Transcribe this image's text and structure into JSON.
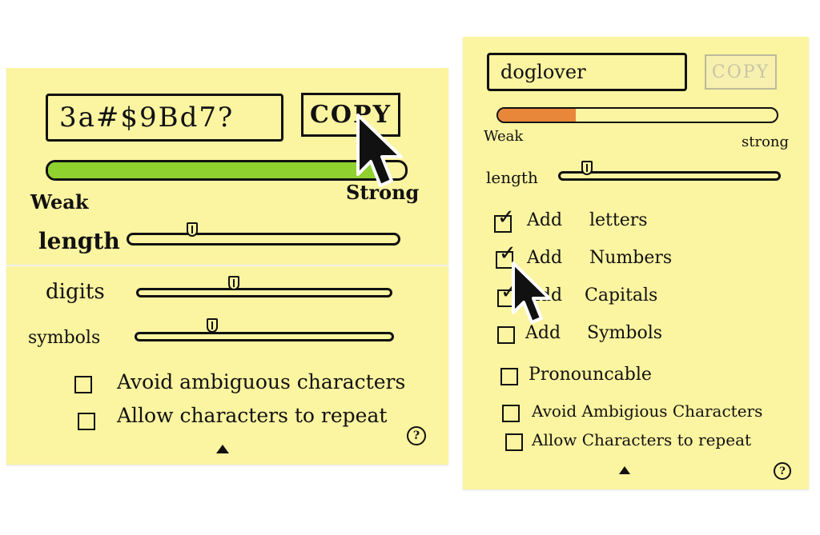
{
  "left": {
    "password_value": "3a#$9Bd7?",
    "copy_label": "COPY",
    "strength": {
      "weak_label": "Weak",
      "strong_label": "Strong",
      "fill_fraction": 0.92,
      "fill_color": "#8fd230"
    },
    "sliders": [
      {
        "label": "length",
        "value": 0.24
      },
      {
        "label": "digits",
        "value": 0.38
      },
      {
        "label": "symbols",
        "value": 0.3
      }
    ],
    "options": [
      {
        "label": "Avoid ambiguous characters",
        "checked": false
      },
      {
        "label": "Allow characters to repeat",
        "checked": false
      }
    ],
    "help_label": "?"
  },
  "right": {
    "password_value": "doglover",
    "copy_label": "COPY",
    "strength": {
      "weak_label": "Weak",
      "strong_label": "strong",
      "fill_fraction": 0.28,
      "fill_color": "#e8863a"
    },
    "length_label": "length",
    "length_value": 0.13,
    "add_options": [
      {
        "add_label": "Add",
        "label": "letters",
        "checked": true
      },
      {
        "add_label": "Add",
        "label": "Numbers",
        "checked": true
      },
      {
        "add_label": "Add",
        "label": "Capitals",
        "checked": true
      },
      {
        "add_label": "Add",
        "label": "Symbols",
        "checked": false
      }
    ],
    "options": [
      {
        "label": "Pronouncable",
        "checked": false
      },
      {
        "label": "Avoid Ambigious Characters",
        "checked": false
      },
      {
        "label": "Allow Characters to repeat",
        "checked": false
      }
    ],
    "help_label": "?"
  },
  "icons": {
    "cursor": "mouse-pointer-icon",
    "expand": "triangle-up-icon",
    "help": "question-mark-icon",
    "check": "checkmark-icon"
  }
}
